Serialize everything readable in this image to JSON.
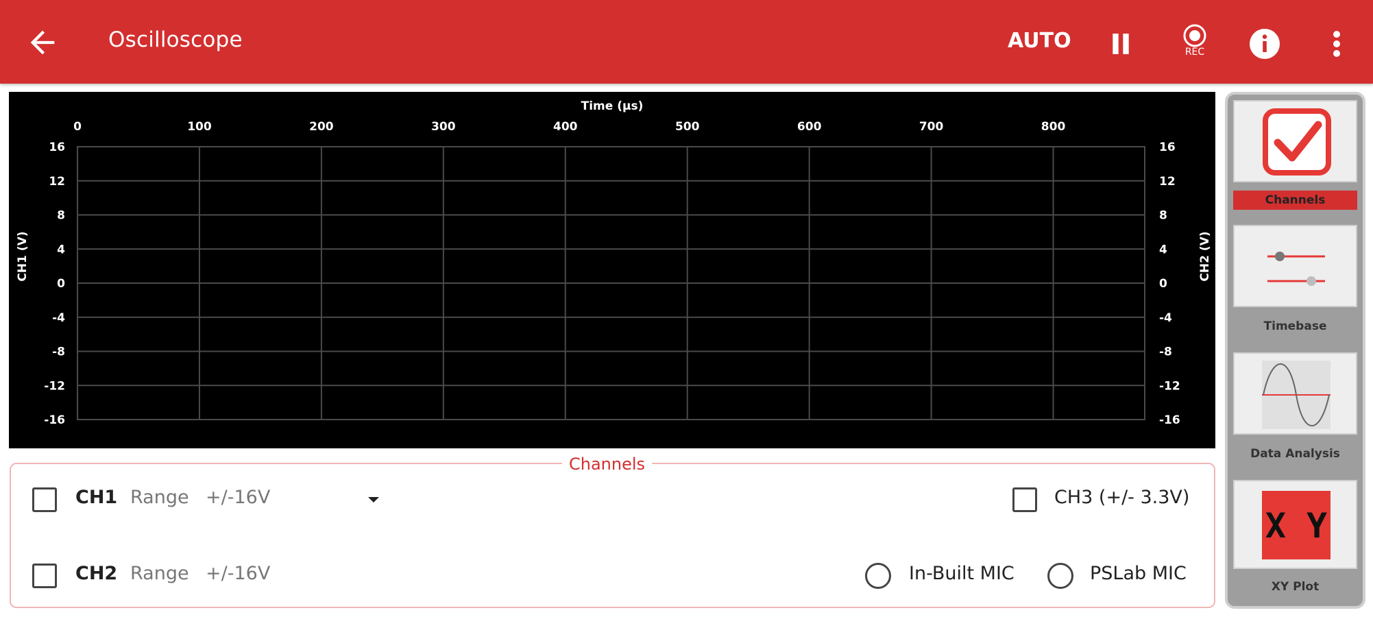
{
  "header": {
    "title": "Oscilloscope",
    "auto_label": "AUTO",
    "rec_label": "REC",
    "back_icon": "arrow-back-icon",
    "pause_icon": "pause-icon",
    "record_icon": "record-icon",
    "info_icon": "info-icon",
    "more_icon": "more-vertical-icon",
    "accent_color": "#d32f2f"
  },
  "chart_data": {
    "type": "line",
    "xlabel": "Time (μs)",
    "ylabel_left": "CH1 (V)",
    "ylabel_right": "CH2 (V)",
    "xlim": [
      0,
      875
    ],
    "ylim": [
      -16,
      16
    ],
    "x_ticks": [
      0,
      100,
      200,
      300,
      400,
      500,
      600,
      700,
      800
    ],
    "y_ticks": [
      16,
      12,
      8,
      4,
      0,
      -4,
      -8,
      -12,
      -16
    ],
    "grid": true,
    "series": []
  },
  "channels": {
    "title": "Channels",
    "ch1": {
      "label": "CH1",
      "range_label": "Range",
      "range_value": "+/-16V",
      "checked": false
    },
    "ch2": {
      "label": "CH2",
      "range_label": "Range",
      "range_value": "+/-16V",
      "checked": false
    },
    "ch3": {
      "label": "CH3 (+/- 3.3V)",
      "checked": false
    },
    "mic_inbuilt": {
      "label": "In-Built MIC",
      "selected": false
    },
    "mic_pslab": {
      "label": "PSLab MIC",
      "selected": false
    }
  },
  "sidebar": {
    "items": [
      {
        "label": "Channels",
        "icon": "checkbox-checked-icon",
        "active": true
      },
      {
        "label": "Timebase",
        "icon": "sliders-icon",
        "active": false
      },
      {
        "label": "Data Analysis",
        "icon": "sine-wave-icon",
        "active": false
      },
      {
        "label": "XY Plot",
        "icon": "xy-plot-icon",
        "icon_text": "X Y",
        "active": false
      }
    ]
  }
}
